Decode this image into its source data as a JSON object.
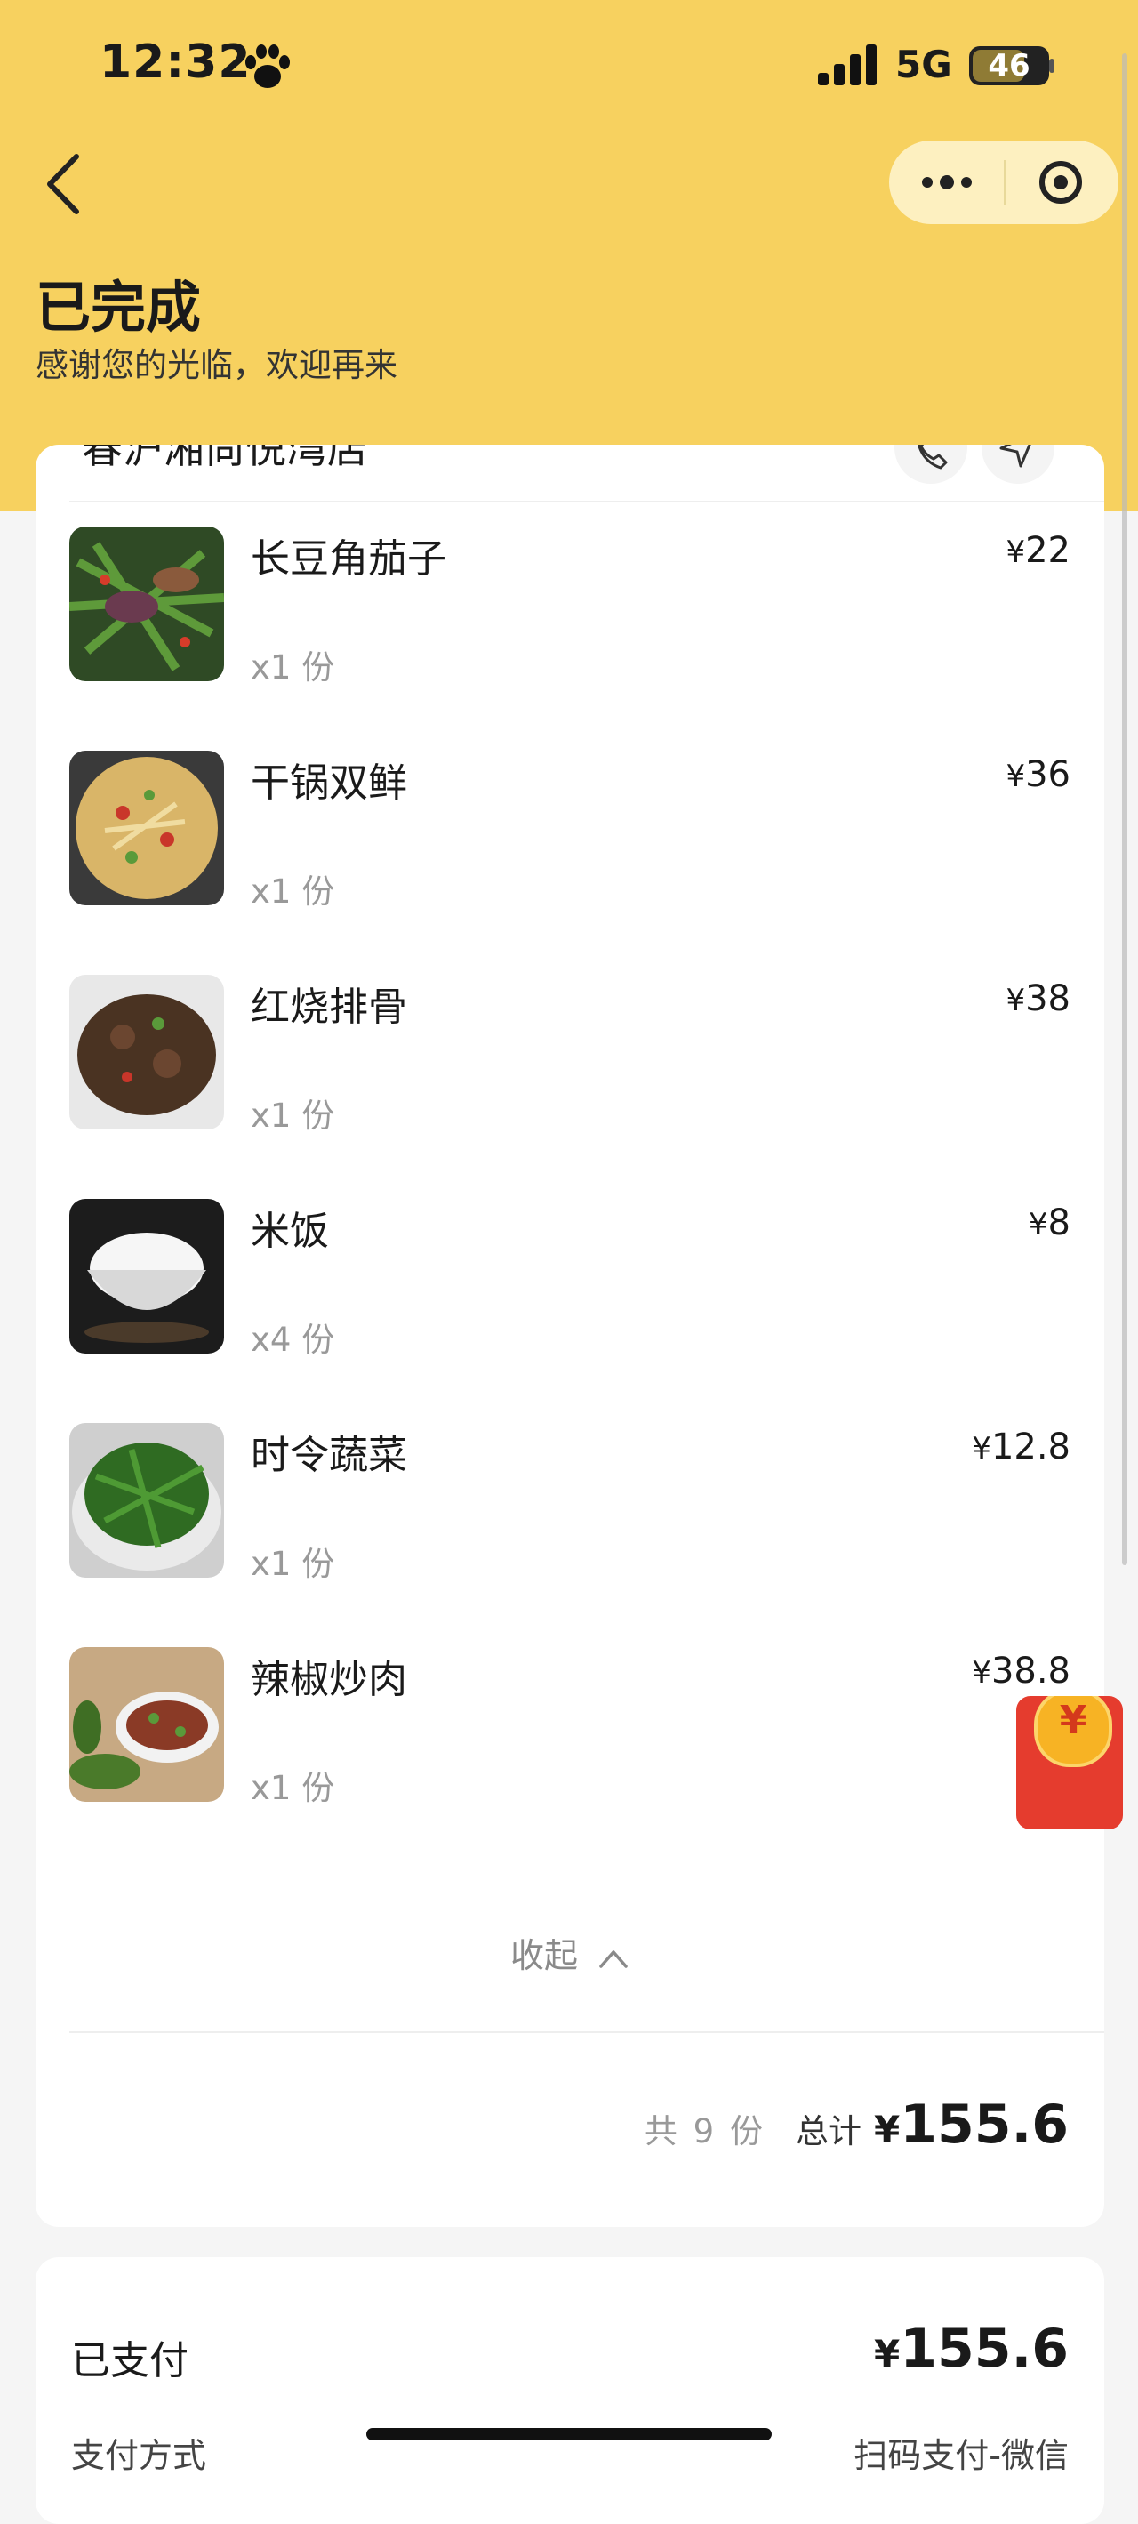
{
  "status_bar": {
    "time": "12:32",
    "network": "5G",
    "battery": "46"
  },
  "header": {
    "title": "已完成",
    "subtitle": "感谢您的光临，欢迎再来"
  },
  "store": {
    "name": "春沪湘尚悦湾店"
  },
  "items": [
    {
      "name": "长豆角茄子",
      "qty": "x1 份",
      "price": "22"
    },
    {
      "name": "干锅双鲜",
      "qty": "x1 份",
      "price": "36"
    },
    {
      "name": "红烧排骨",
      "qty": "x1 份",
      "price": "38"
    },
    {
      "name": "米饭",
      "qty": "x4 份",
      "price": "8"
    },
    {
      "name": "时令蔬菜",
      "qty": "x1 份",
      "price": "12.8"
    },
    {
      "name": "辣椒炒肉",
      "qty": "x1 份",
      "price": "38.8"
    }
  ],
  "currency": "¥",
  "collapse_label": "收起",
  "summary": {
    "count": "共 9 份",
    "total_label": "总计",
    "total": "155.6"
  },
  "payment": {
    "paid_label": "已支付",
    "paid_amount": "155.6",
    "method_label": "支付方式",
    "method_value": "扫码支付-微信"
  },
  "red_packet": {
    "symbol": "¥"
  },
  "icons": [
    "paw-icon",
    "signal-icon",
    "back-icon",
    "more-icon",
    "target-icon",
    "phone-icon",
    "navigate-icon",
    "chevron-up-icon",
    "red-packet-icon"
  ],
  "colors": {
    "header": "#f7d15f",
    "capsule": "#fdf0c0",
    "muted": "#999999",
    "red_packet": "#e53c2e"
  }
}
